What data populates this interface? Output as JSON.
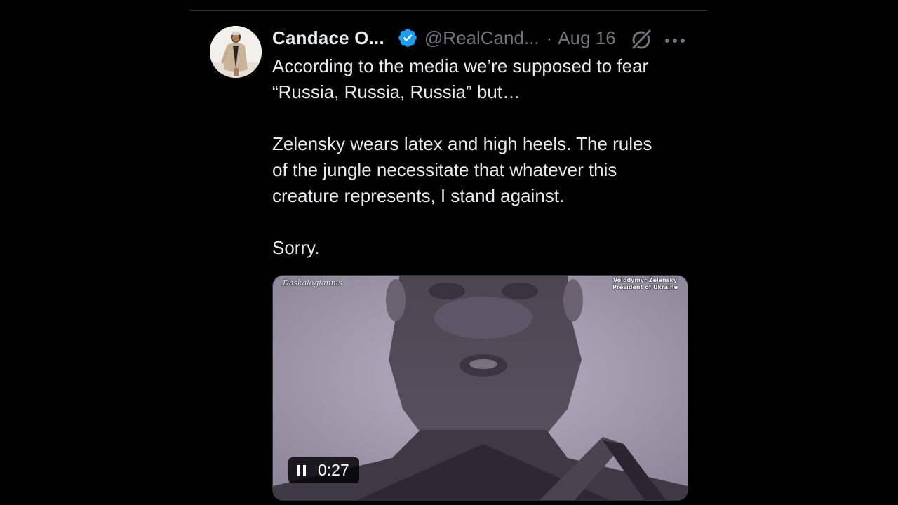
{
  "post": {
    "author": {
      "display_name": "Candace O...",
      "handle": "@RealCand...",
      "verified": true
    },
    "separator": "·",
    "date": "Aug 16",
    "icons": {
      "grok": "grok-icon",
      "more": "more-icon",
      "verified": "verified-badge-icon"
    },
    "text": {
      "paragraph_1": "According to the media we’re supposed to fear\n“Russia, Russia, Russia” but…",
      "paragraph_2": "Zelensky wears latex and high heels. The rules\nof the jungle necessitate that whatever this\ncreature represents, I stand against.",
      "paragraph_3": "Sorry."
    },
    "media": {
      "type": "video",
      "watermark": "Daskalogiannis",
      "caption_line_1": "Volodymyr Zelensky",
      "caption_line_2": "President of Ukraine",
      "player": {
        "state": "playing",
        "control_icon": "pause-icon",
        "duration": "0:27"
      }
    }
  },
  "colors": {
    "background": "#000000",
    "primary_text": "#e7e9ea",
    "secondary_text": "#71767b",
    "verified_blue": "#1d9bf0",
    "divider": "#2f3336"
  }
}
